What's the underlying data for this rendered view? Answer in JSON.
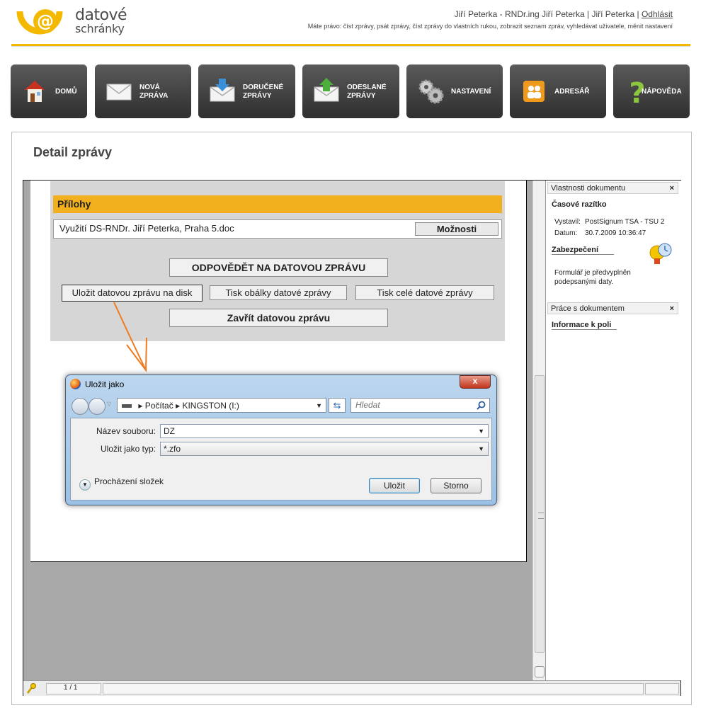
{
  "brand": {
    "line1": "datové",
    "line2": "schránky"
  },
  "header": {
    "user_text": "Jiří Peterka - RNDr.ing Jiří Peterka | Jiří Peterka |",
    "logout": "Odhlásit",
    "rights": "Máte právo: číst zprávy, psát zprávy, číst zprávy do vlastních rukou, zobrazit seznam zpráv, vyhledávat uživatele, měnit nastavení"
  },
  "nav": {
    "home": "DOMŮ",
    "new_msg": "NOVÁ\nZPRÁVA",
    "received": "DORUČENÉ\nZPRÁVY",
    "sent": "ODESLANÉ\nZPRÁVY",
    "settings": "NASTAVENÍ",
    "addressbook": "ADRESÁŘ",
    "help": "NÁPOVĚDA"
  },
  "page_title": "Detail zprávy",
  "attachments": {
    "title": "Přílohy",
    "file_name": "Využití DS-RNDr. Jiří Peterka, Praha 5.doc",
    "options": "Možnosti"
  },
  "actions": {
    "reply": "ODPOVĚDĚT NA DATOVOU ZPRÁVU",
    "save": "Uložit datovou zprávu na disk",
    "print_envelope": "Tisk obálky datové zprávy",
    "print_full": "Tisk celé datové zprávy",
    "close": "Zavřít datovou zprávu"
  },
  "side": {
    "props_header": "Vlastnosti dokumentu",
    "timestamp_title": "Časové razítko",
    "issuer_label": "Vystavil:",
    "issuer": "PostSignum TSA - TSU 2",
    "date_label": "Datum:",
    "date": "30.7.2009 10:36:47",
    "security_title": "Zabezpečení",
    "security_text": "Formulář je předvyplněn podepsanými daty.",
    "work_header": "Práce s dokumentem",
    "field_info": "Informace k poli"
  },
  "status": {
    "page": "1 / 1"
  },
  "dialog": {
    "title": "Uložit jako",
    "close": "x",
    "path_root": "Počítač",
    "path_drive": "KINGSTON (I:)",
    "search_placeholder": "Hledat",
    "filename_label": "Název souboru:",
    "filename_value": "DZ",
    "type_label": "Uložit jako typ:",
    "type_value": "*.zfo",
    "browse": "Procházení složek",
    "save": "Uložit",
    "cancel": "Storno"
  },
  "colors": {
    "accent": "#f3b800",
    "annotation_arrow": "#f07a1e"
  }
}
